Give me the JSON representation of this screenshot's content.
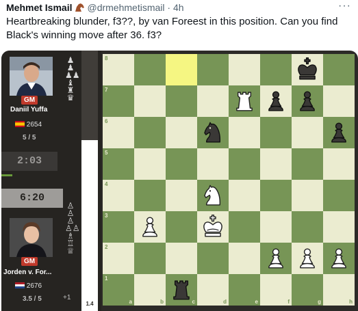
{
  "tweet": {
    "author_name": "Mehmet Ismail",
    "handle": "@drmehmetismail",
    "separator": "·",
    "time": "4h",
    "more": "···",
    "text": "Heartbreaking blunder, f3??, by van Foreest in this position. Can you find Black's winning move after 36. f3?"
  },
  "game": {
    "top_player": {
      "title": "GM",
      "name": "Daniil Yuffa",
      "rating": "2654",
      "score": "5 / 5",
      "clock": "2:03"
    },
    "bottom_player": {
      "title": "GM",
      "name": "Jorden v. For...",
      "rating": "2676",
      "score": "3.5 / 5",
      "clock": "6:20",
      "material_advantage": "+1"
    },
    "eval": "1.4",
    "captured_by_top": [
      "♟",
      "♟",
      "♟♟",
      "♝",
      "♜",
      "♛"
    ],
    "captured_by_bottom": [
      "♙",
      "♙",
      "♙",
      "♙♙",
      "♗",
      "♖",
      "♕"
    ],
    "colors": {
      "light_square": "#ebecd0",
      "dark_square": "#779556",
      "highlight": "#f5f682",
      "panel": "#262421"
    },
    "board": {
      "rank_labels": [
        "8",
        "7",
        "6",
        "5",
        "4",
        "3",
        "2",
        "1"
      ],
      "file_labels": [
        "a",
        "b",
        "c",
        "d",
        "e",
        "f",
        "g",
        "h"
      ],
      "highlighted_square": "c8",
      "pieces": [
        {
          "square": "g8",
          "type": "king",
          "color": "black"
        },
        {
          "square": "e7",
          "type": "rook",
          "color": "white"
        },
        {
          "square": "f7",
          "type": "pawn",
          "color": "black"
        },
        {
          "square": "g7",
          "type": "pawn",
          "color": "black"
        },
        {
          "square": "d6",
          "type": "knight",
          "color": "black"
        },
        {
          "square": "h6",
          "type": "pawn",
          "color": "black"
        },
        {
          "square": "d4",
          "type": "knight",
          "color": "white"
        },
        {
          "square": "b3",
          "type": "pawn",
          "color": "white"
        },
        {
          "square": "d3",
          "type": "king",
          "color": "white"
        },
        {
          "square": "f2",
          "type": "pawn",
          "color": "white"
        },
        {
          "square": "g2",
          "type": "pawn",
          "color": "white"
        },
        {
          "square": "h2",
          "type": "pawn",
          "color": "white"
        },
        {
          "square": "c1",
          "type": "rook",
          "color": "black"
        }
      ]
    }
  }
}
